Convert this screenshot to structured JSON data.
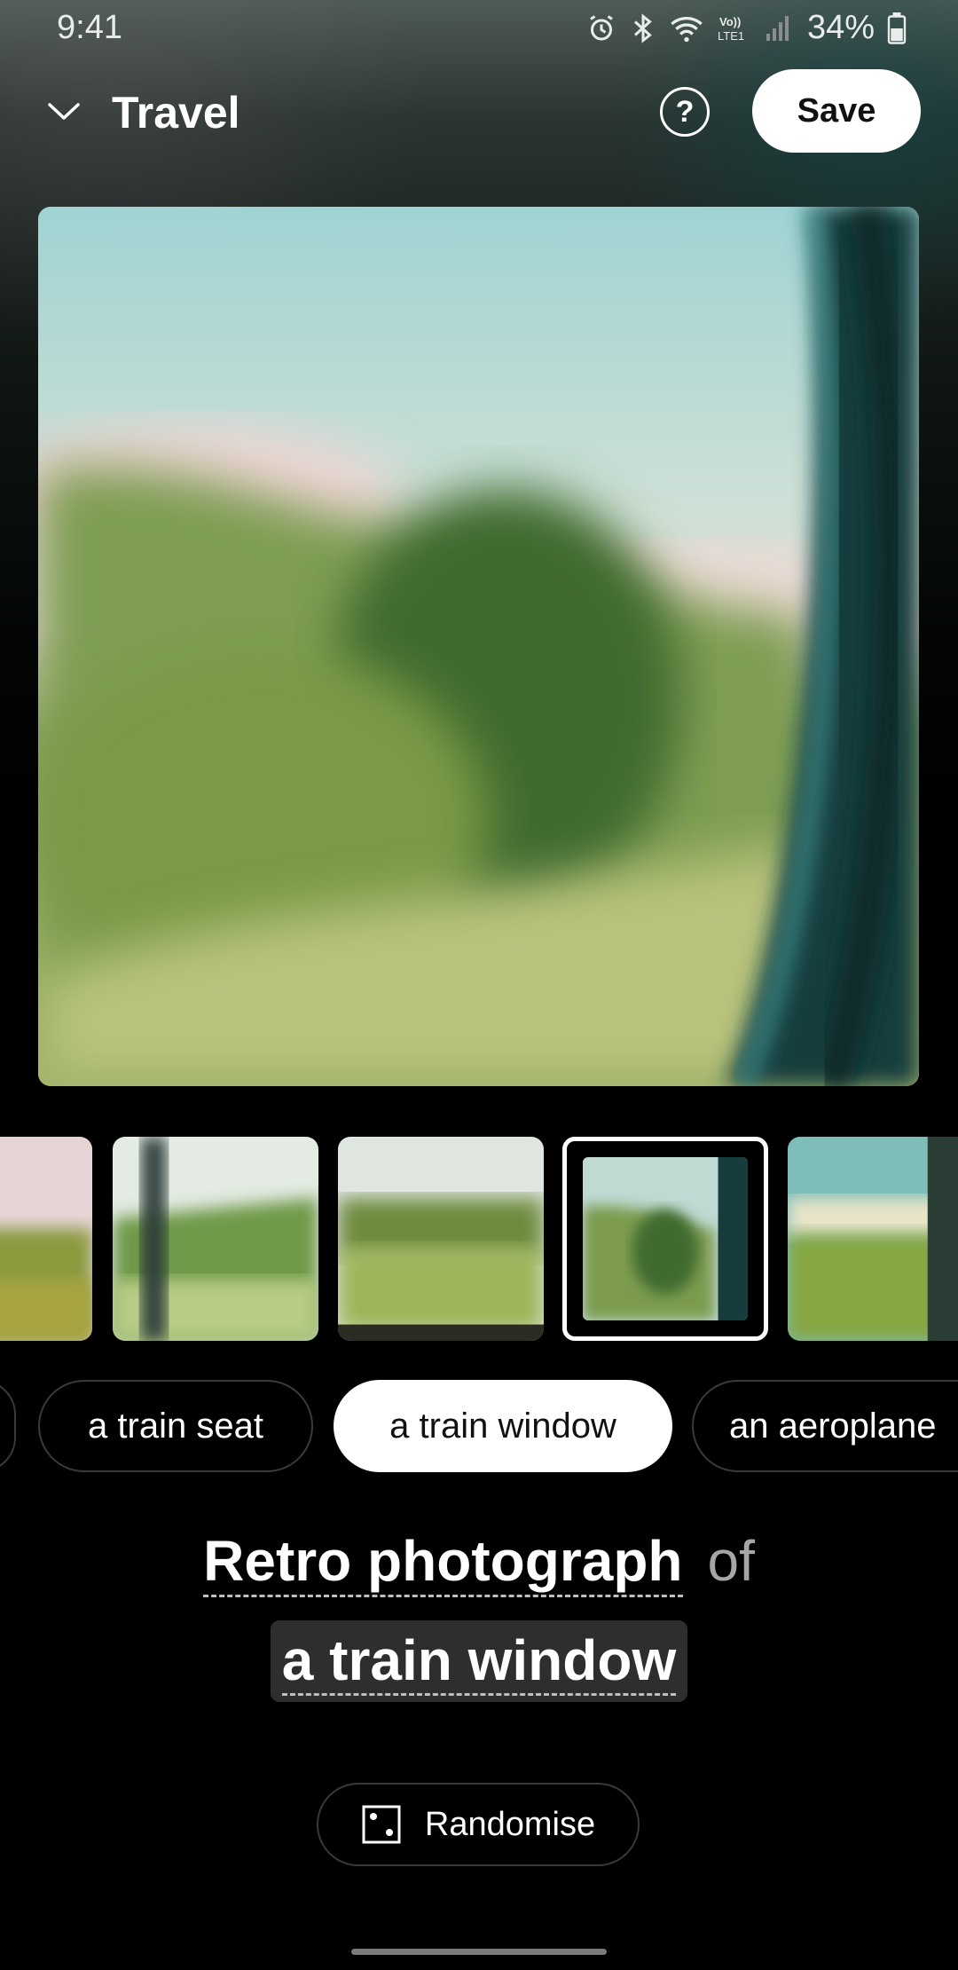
{
  "status_bar": {
    "time": "9:41",
    "battery": "34%",
    "icons": [
      "alarm-icon",
      "bluetooth-icon",
      "wifi-icon",
      "volte-icon",
      "signal-icon",
      "battery-icon"
    ]
  },
  "header": {
    "title": "Travel",
    "help_label": "?",
    "save_label": "Save"
  },
  "thumbnails": {
    "selected_index": 3,
    "count_visible": 5
  },
  "chips": [
    {
      "label": "",
      "selected": false
    },
    {
      "label": "a train seat",
      "selected": false
    },
    {
      "label": "a train window",
      "selected": true
    },
    {
      "label": "an aeroplane",
      "selected": false
    }
  ],
  "prompt": {
    "style": "Retro photograph",
    "connector": "of",
    "subject": "a train window"
  },
  "randomise": {
    "label": "Randomise"
  },
  "colors": {
    "background": "#000000",
    "accent_white": "#ffffff",
    "muted_text": "#a6a6a6"
  }
}
